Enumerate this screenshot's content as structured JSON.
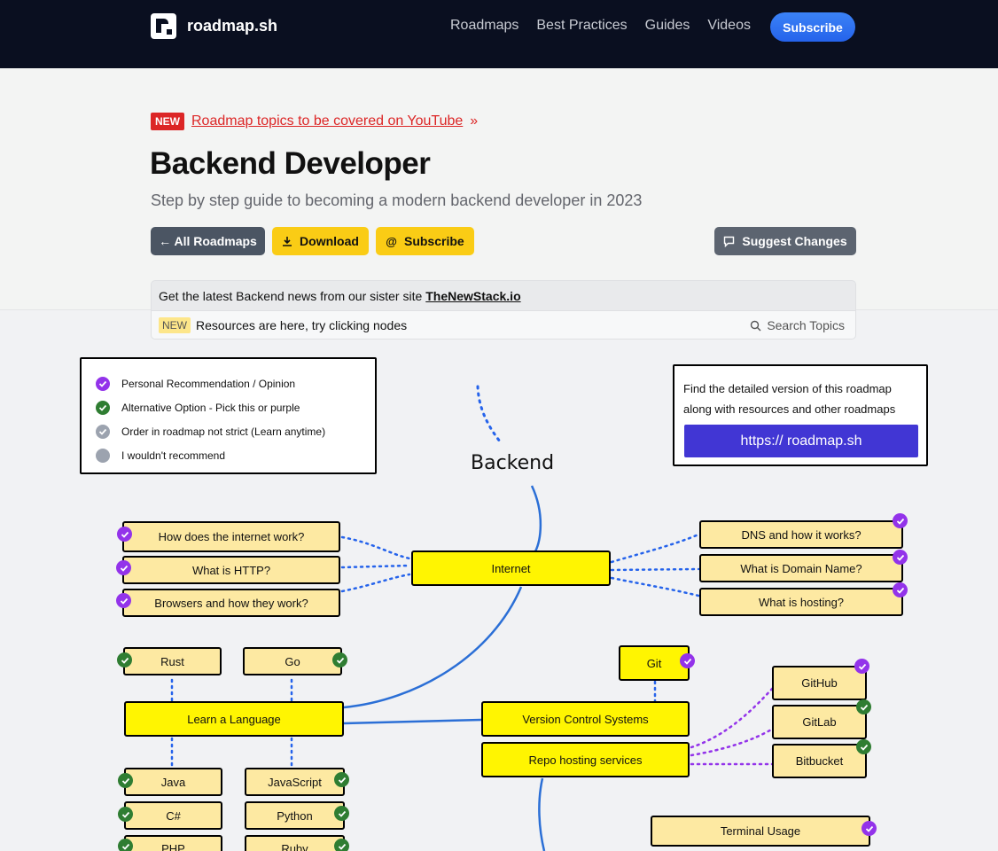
{
  "nav": {
    "logo_text": "roadmap.sh",
    "links": [
      "Roadmaps",
      "Best Practices",
      "Guides",
      "Videos"
    ],
    "subscribe": "Subscribe"
  },
  "banner": {
    "badge": "NEW",
    "link_text": "Roadmap topics to be covered on YouTube",
    "suffix": "»"
  },
  "page": {
    "title": "Backend Developer",
    "subtitle": "Step by step guide to becoming a modern backend developer in 2023"
  },
  "buttons": {
    "all_roadmaps": "← All Roadmaps",
    "download": "Download",
    "subscribe": "Subscribe",
    "suggest": "Suggest Changes"
  },
  "news": {
    "text": "Get the latest Backend news from our sister site",
    "link": "TheNewStack.io"
  },
  "resources": {
    "badge": "NEW",
    "text": "Resources are here, try clicking nodes",
    "search": "Search Topics"
  },
  "legend": {
    "items": [
      {
        "label": "Personal Recommendation / Opinion",
        "color": "#9333ea"
      },
      {
        "label": "Alternative Option - Pick this or purple",
        "color": "#2f7d32"
      },
      {
        "label": "Order in roadmap not strict (Learn anytime)",
        "color": "#9ca3af"
      },
      {
        "label": "I wouldn't recommend",
        "color": "#9ca3af"
      }
    ]
  },
  "promo": {
    "line1": "Find the detailed version of this roadmap",
    "line2": "along with resources and other roadmaps",
    "button": "https:// roadmap.sh"
  },
  "roadmap": {
    "root": "Backend",
    "internet": "Internet",
    "internet_topics": [
      "How does the internet work?",
      "What is HTTP?",
      "Browsers and how they work?"
    ],
    "dns_topics": [
      "DNS and how it works?",
      "What is Domain Name?",
      "What is hosting?"
    ],
    "learn_language": "Learn a Language",
    "languages": [
      "Rust",
      "Go",
      "Java",
      "JavaScript",
      "C#",
      "Python",
      "PHP",
      "Ruby"
    ],
    "git": "Git",
    "vcs": "Version Control Systems",
    "repo_hosting": "Repo hosting services",
    "hosts": [
      "GitHub",
      "GitLab",
      "Bitbucket"
    ],
    "terminal": "Terminal Usage"
  }
}
